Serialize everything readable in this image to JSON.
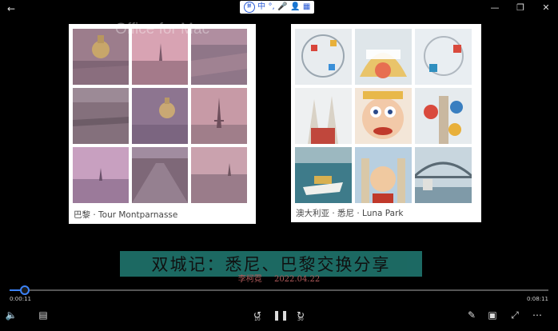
{
  "ime_bar": {
    "logo": "拼",
    "lang": "中",
    "punct": "°,",
    "voice": "🎤",
    "user": "👤",
    "grid": "▦"
  },
  "slide": {
    "watermark": "Office for Mac",
    "left_caption": "巴黎 · Tour Montparnasse",
    "right_caption": "澳大利亚 · 悉尼 · Luna Park",
    "title": "双城记：悉尼、巴黎交换分享",
    "presenter": "李柯霓",
    "date": "2022.04.22"
  },
  "player": {
    "elapsed": "0:00:11",
    "total": "0:08:11",
    "progress": 0.028,
    "rewind_seconds": "10",
    "forward_seconds": "30"
  },
  "colors": {
    "accent": "#3b82f6",
    "banner": "#1e6f68"
  }
}
